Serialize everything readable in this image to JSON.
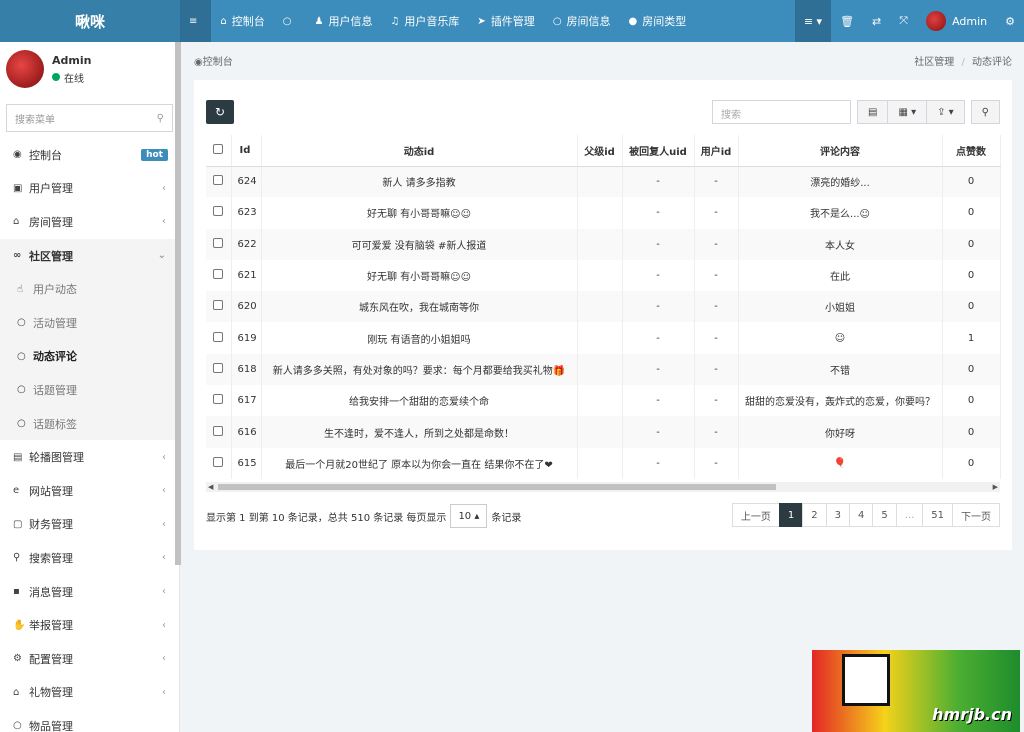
{
  "app": {
    "logo": "啾咪"
  },
  "topnav": [
    {
      "icon": "≡",
      "label": ""
    },
    {
      "icon": "⌂",
      "label": "控制台"
    },
    {
      "icon": "○",
      "label": ""
    },
    {
      "icon": "♟",
      "label": "用户信息"
    },
    {
      "icon": "♫",
      "label": "用户音乐库"
    },
    {
      "icon": "➤",
      "label": "插件管理"
    },
    {
      "icon": "○",
      "label": "房间信息"
    },
    {
      "icon": "●",
      "label": "房间类型"
    }
  ],
  "topright": {
    "menu_icon": "≡ ▾",
    "trash_icon": "🗑",
    "lang_icon": "⇄",
    "fullscreen_icon": "⤧",
    "user": "Admin",
    "settings_icon": "⚙"
  },
  "user_panel": {
    "name": "Admin",
    "status": "在线"
  },
  "sidebar": {
    "search_placeholder": "搜索菜单",
    "items": [
      {
        "icon": "◉",
        "label": "控制台",
        "badge": "hot"
      },
      {
        "icon": "▣",
        "label": "用户管理"
      },
      {
        "icon": "⌂",
        "label": "房间管理"
      },
      {
        "icon": "∞",
        "label": "社区管理"
      }
    ],
    "sub_items": [
      {
        "icon": "☝",
        "label": "用户动态"
      },
      {
        "icon": "○",
        "label": "活动管理"
      },
      {
        "icon": "○",
        "label": "动态评论"
      },
      {
        "icon": "○",
        "label": "话题管理"
      },
      {
        "icon": "○",
        "label": "话题标签"
      }
    ],
    "items_after": [
      {
        "icon": "▤",
        "label": "轮播图管理"
      },
      {
        "icon": "e",
        "label": "网站管理"
      },
      {
        "icon": "▢",
        "label": "财务管理"
      },
      {
        "icon": "⚲",
        "label": "搜索管理"
      },
      {
        "icon": "▪",
        "label": "消息管理"
      },
      {
        "icon": "✋",
        "label": "举报管理"
      },
      {
        "icon": "⚙",
        "label": "配置管理"
      },
      {
        "icon": "⌂",
        "label": "礼物管理"
      },
      {
        "icon": "○",
        "label": "物品管理"
      }
    ]
  },
  "breadcrumb": {
    "title": "控制台",
    "path1": "社区管理",
    "path2": "动态评论"
  },
  "toolbar": {
    "search_placeholder": "搜索"
  },
  "table": {
    "columns": [
      "Id",
      "动态id",
      "父级id",
      "被回复人uid",
      "用户id",
      "评论内容",
      "点赞数"
    ],
    "rows": [
      {
        "id": "624",
        "dyn": "新人 请多多指教",
        "parent": "",
        "reply_uid": "-",
        "uid": "-",
        "content": "漂亮的婚纱...",
        "likes": "0"
      },
      {
        "id": "623",
        "dyn": "好无聊 有小哥哥嘛☺☺",
        "parent": "",
        "reply_uid": "-",
        "uid": "-",
        "content": "我不是么...☺",
        "likes": "0"
      },
      {
        "id": "622",
        "dyn": "可可爱爱 没有脑袋 #新人报道",
        "parent": "",
        "reply_uid": "-",
        "uid": "-",
        "content": "本人女",
        "likes": "0"
      },
      {
        "id": "621",
        "dyn": "好无聊 有小哥哥嘛☺☺",
        "parent": "",
        "reply_uid": "-",
        "uid": "-",
        "content": "在此",
        "likes": "0"
      },
      {
        "id": "620",
        "dyn": "城东风在吹，我在城南等你",
        "parent": "",
        "reply_uid": "-",
        "uid": "-",
        "content": "小姐姐",
        "likes": "0"
      },
      {
        "id": "619",
        "dyn": "刚玩 有语音的小姐姐吗",
        "parent": "",
        "reply_uid": "-",
        "uid": "-",
        "content": "☺",
        "likes": "1"
      },
      {
        "id": "618",
        "dyn": "新人请多多关照，有处对象的吗？要求：每个月都要给我买礼物🎁",
        "parent": "",
        "reply_uid": "-",
        "uid": "-",
        "content": "不错",
        "likes": "0"
      },
      {
        "id": "617",
        "dyn": "给我安排一个甜甜的恋爱续个命",
        "parent": "",
        "reply_uid": "-",
        "uid": "-",
        "content": "甜甜的恋爱没有，轰炸式的恋爱，你要吗？",
        "likes": "0"
      },
      {
        "id": "616",
        "dyn": "生不逢时，爱不逢人，所到之处都是命数！",
        "parent": "",
        "reply_uid": "-",
        "uid": "-",
        "content": "你好呀",
        "likes": "0"
      },
      {
        "id": "615",
        "dyn": "最后一个月就20世纪了 原本以为你会一直在 结果你不在了❤",
        "parent": "",
        "reply_uid": "-",
        "uid": "-",
        "content": "🎈",
        "likes": "0"
      }
    ]
  },
  "pager": {
    "info_prefix": "显示第 1 到第 10 条记录，总共 510 条记录 每页显示",
    "page_size": "10 ▴",
    "info_suffix": "条记录",
    "prev": "上一页",
    "pages": [
      "1",
      "2",
      "3",
      "4",
      "5",
      "...",
      "51"
    ],
    "next": "下一页"
  },
  "watermark": {
    "text": "hmrjb.cn"
  }
}
